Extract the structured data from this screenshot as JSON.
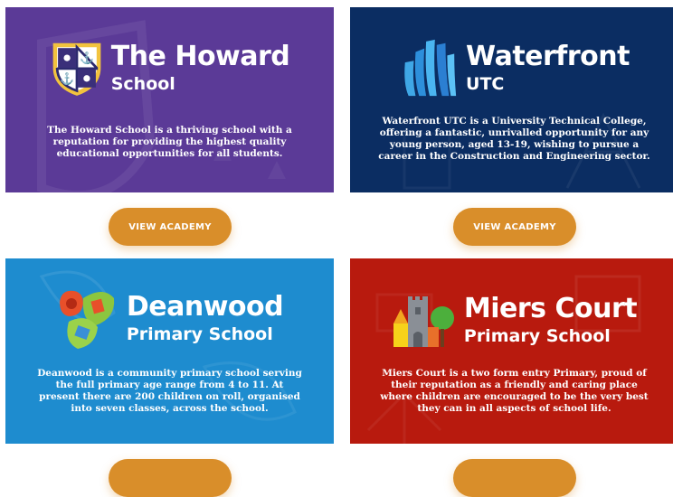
{
  "colors": {
    "howard": "#5b3a97",
    "waterfront": "#0b2d62",
    "deanwood": "#1e8ccf",
    "miers": "#b81a0e",
    "button": "#d98e2a"
  },
  "cards": [
    {
      "title": "The Howard",
      "subtitle": "School",
      "description": "The Howard School is a thriving school with a reputation for providing the highest quality educational opportunities for all students.",
      "button": "VIEW ACADEMY",
      "icon": "shield-crest-icon"
    },
    {
      "title": "Waterfront",
      "subtitle": "UTC",
      "description": "Waterfront UTC is a University Technical College, offering a fantastic, unrivalled opportunity for any young person, aged 13-19, wishing to pursue a career in the Construction and Engineering sector.",
      "button": "VIEW ACADEMY",
      "icon": "bar-bundle-icon"
    },
    {
      "title": "Deanwood",
      "subtitle": "Primary School",
      "description": "Deanwood is a community primary school serving the full primary age range from 4 to 11. At present there are 200 children on roll, organised into seven classes, across the school.",
      "button": "",
      "icon": "leaves-icon"
    },
    {
      "title": "Miers Court",
      "subtitle": "Primary School",
      "description": "Miers Court is a two form entry Primary, proud of their reputation as a friendly and caring place where children are encouraged to be the very best they can in all aspects of school life.",
      "button": "",
      "icon": "castle-tree-icon"
    }
  ]
}
